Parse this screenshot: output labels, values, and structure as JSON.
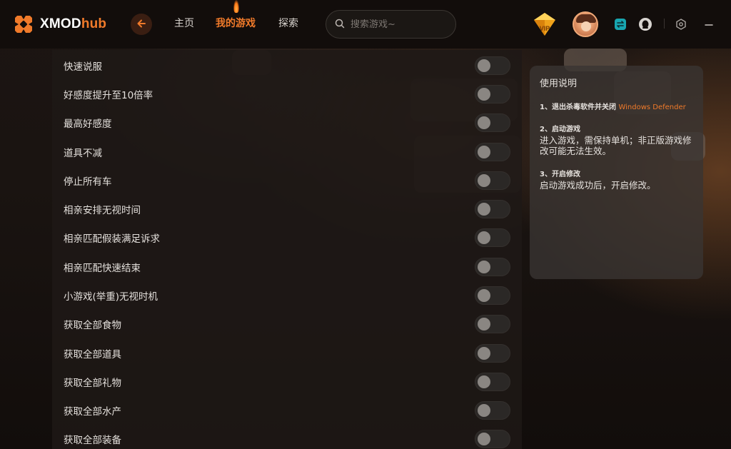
{
  "header": {
    "logo": {
      "brand": "XMOD",
      "suffix": "hub"
    },
    "nav": [
      {
        "label": "主页",
        "active": false
      },
      {
        "label": "我的游戏",
        "active": true
      },
      {
        "label": "探索",
        "active": false
      }
    ],
    "search": {
      "placeholder": "搜索游戏~",
      "value": ""
    },
    "vip_label": "VIP",
    "accent_color": "#f07a2a"
  },
  "cheats": [
    {
      "label": "快速说服",
      "enabled": false
    },
    {
      "label": "好感度提升至10倍率",
      "enabled": false
    },
    {
      "label": "最高好感度",
      "enabled": false
    },
    {
      "label": "道具不减",
      "enabled": false
    },
    {
      "label": "停止所有车",
      "enabled": false
    },
    {
      "label": "相亲安排无视时间",
      "enabled": false
    },
    {
      "label": "相亲匹配假装满足诉求",
      "enabled": false
    },
    {
      "label": "相亲匹配快速结束",
      "enabled": false
    },
    {
      "label": "小游戏(举重)无视时机",
      "enabled": false
    },
    {
      "label": "获取全部食物",
      "enabled": false
    },
    {
      "label": "获取全部道具",
      "enabled": false
    },
    {
      "label": "获取全部礼物",
      "enabled": false
    },
    {
      "label": "获取全部水产",
      "enabled": false
    },
    {
      "label": "获取全部装备",
      "enabled": false
    }
  ],
  "instructions": {
    "title": "使用说明",
    "steps": [
      {
        "title": "1、退出杀毒软件并关闭",
        "highlight": "Windows Defender",
        "text": ""
      },
      {
        "title": "2、启动游戏",
        "highlight": "",
        "text": "进入游戏，需保持单机；非正版游戏修改可能无法生效。"
      },
      {
        "title": "3、开启修改",
        "highlight": "",
        "text": "启动游戏成功后，开启修改。"
      }
    ]
  }
}
